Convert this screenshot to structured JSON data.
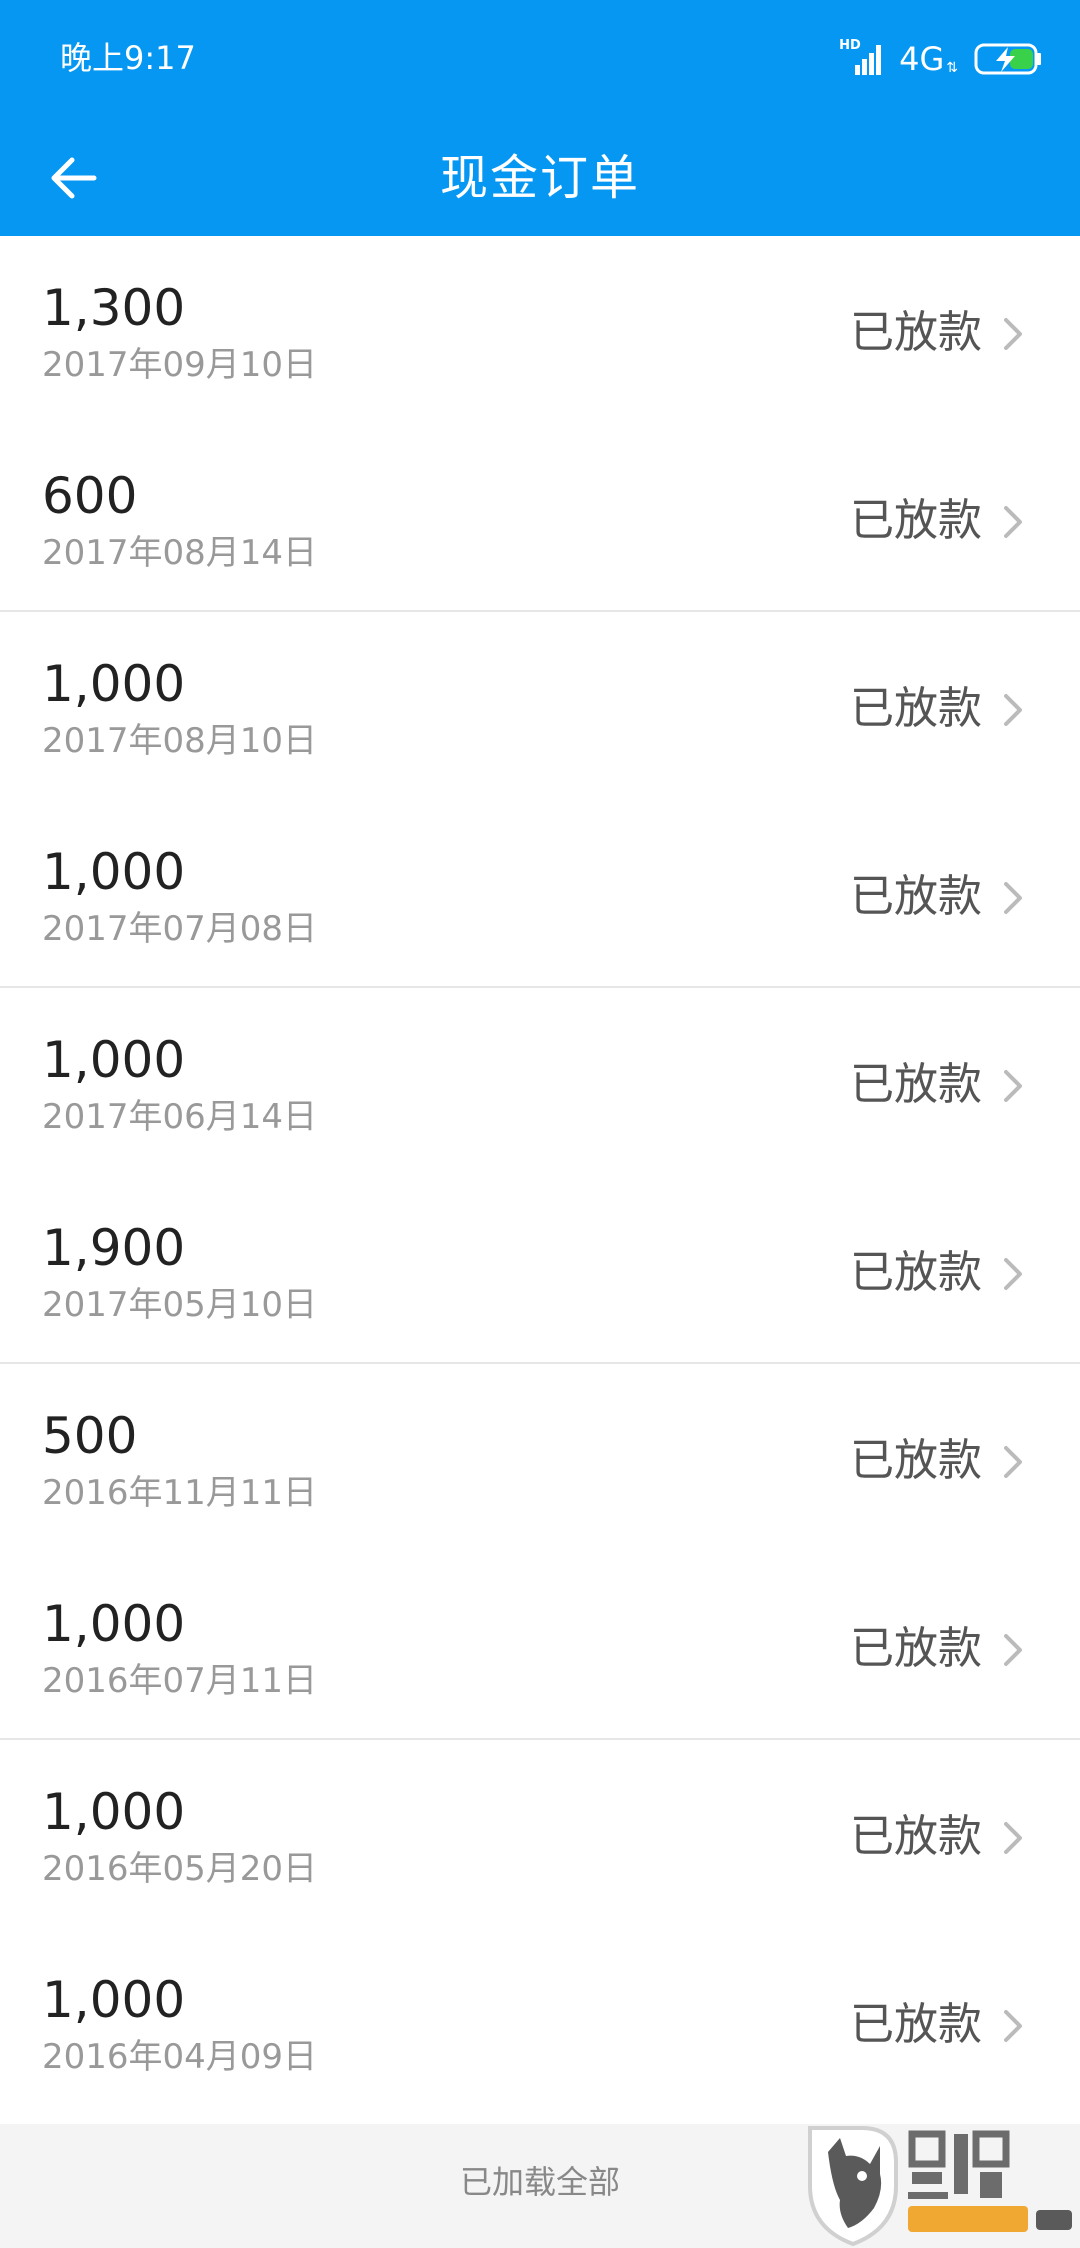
{
  "status_bar": {
    "time": "晚上9:17",
    "hd": "HD",
    "network": "4G",
    "data_arrows": "⇅",
    "icons": [
      "signal-icon",
      "battery-charging-icon"
    ]
  },
  "nav": {
    "back_icon": "back-arrow-icon",
    "title": "现金订单"
  },
  "orders": [
    {
      "amount": "1,300",
      "date": "2017年09月10日",
      "status": "已放款"
    },
    {
      "amount": "600",
      "date": "2017年08月14日",
      "status": "已放款"
    },
    {
      "amount": "1,000",
      "date": "2017年08月10日",
      "status": "已放款"
    },
    {
      "amount": "1,000",
      "date": "2017年07月08日",
      "status": "已放款"
    },
    {
      "amount": "1,000",
      "date": "2017年06月14日",
      "status": "已放款"
    },
    {
      "amount": "1,900",
      "date": "2017年05月10日",
      "status": "已放款"
    },
    {
      "amount": "500",
      "date": "2016年11月11日",
      "status": "已放款"
    },
    {
      "amount": "1,000",
      "date": "2016年07月11日",
      "status": "已放款"
    },
    {
      "amount": "1,000",
      "date": "2016年05月20日",
      "status": "已放款"
    },
    {
      "amount": "1,000",
      "date": "2016年04月09日",
      "status": "已放款"
    }
  ],
  "footer": {
    "text": "已加载全部"
  },
  "watermark": {
    "text": "黑猫 BLACK CAT"
  },
  "colors": {
    "header_bg": "#0597f2",
    "battery_fill": "#39d14a",
    "divider": "#e6e6e6"
  }
}
